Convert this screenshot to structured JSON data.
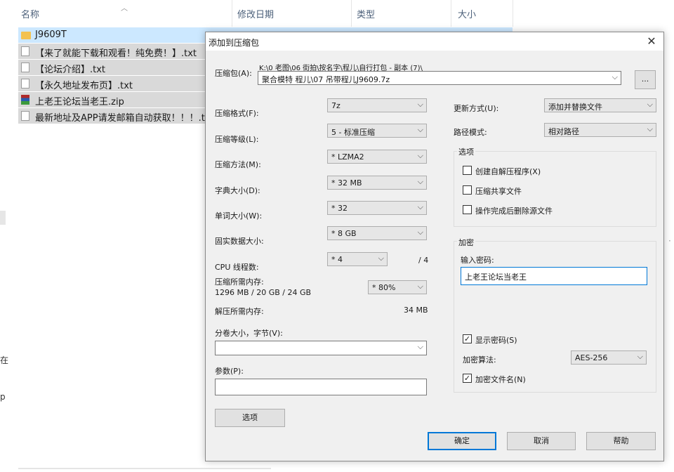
{
  "explorer": {
    "columns": [
      "名称",
      "修改日期",
      "类型",
      "大小"
    ],
    "files": [
      {
        "name": "J9609T",
        "icon": "folder-icon"
      },
      {
        "name": "【来了就能下载和观看！纯免费！】.txt",
        "icon": "text-file-icon"
      },
      {
        "name": "【论坛介绍】.txt",
        "icon": "text-file-icon"
      },
      {
        "name": "【永久地址发布页】.txt",
        "icon": "text-file-icon"
      },
      {
        "name": "上老王论坛当老王.zip",
        "icon": "zip-archive-icon"
      },
      {
        "name": "最新地址及APP请发邮箱自动获取！！！.txt",
        "icon": "text-file-icon"
      }
    ],
    "left_fragments": [
      "在",
      "p"
    ]
  },
  "dialog": {
    "title": "添加到压缩包",
    "close": "✕",
    "archive_label": "压缩包(A):",
    "archive_path": "K:\\0 老图\\06 街拍\\按名字\\程儿\\自行打包 - 副本 (7)\\",
    "archive_name": "聚合模特 程儿\\07 吊带程儿J9609.7z",
    "browse": "...",
    "format_label": "压缩格式(F):",
    "format_value": "7z",
    "level_label": "压缩等级(L):",
    "level_value": "5 - 标准压缩",
    "method_label": "压缩方法(M):",
    "method_value": "* LZMA2",
    "dict_label": "字典大小(D):",
    "dict_value": "* 32 MB",
    "word_label": "单词大小(W):",
    "word_value": "* 32",
    "solid_label": "固实数据大小:",
    "solid_value": "* 8 GB",
    "cpu_label": "CPU 线程数:",
    "cpu_value": "* 4",
    "cpu_total": "/ 4",
    "mem_comp_label": "压缩所需内存:",
    "mem_comp_value": "1296 MB / 20 GB / 24 GB",
    "mem_percent": "* 80%",
    "mem_decomp_label": "解压所需内存:",
    "mem_decomp_value": "34 MB",
    "split_label": "分卷大小，字节(V):",
    "split_value": "",
    "params_label": "参数(P):",
    "params_value": "",
    "options_button": "选项",
    "update_label": "更新方式(U):",
    "update_value": "添加并替换文件",
    "pathmode_label": "路径模式:",
    "pathmode_value": "相对路径",
    "options_group": "选项",
    "opt_sfx": "创建自解压程序(X)",
    "opt_shared": "压缩共享文件",
    "opt_delete": "操作完成后删除源文件",
    "encrypt_group": "加密",
    "pw_label": "输入密码:",
    "pw_value": "上老王论坛当老王",
    "show_pw": "显示密码(S)",
    "show_pw_checked": "✓",
    "enc_method_label": "加密算法:",
    "enc_method_value": "AES-256",
    "enc_names": "加密文件名(N)",
    "enc_names_checked": "✓",
    "ok": "确定",
    "cancel": "取消",
    "help": "帮助"
  },
  "colors": {
    "accent": "#0078d7",
    "selection": "#cce8ff",
    "dialog_bg": "#f0f0f0"
  }
}
